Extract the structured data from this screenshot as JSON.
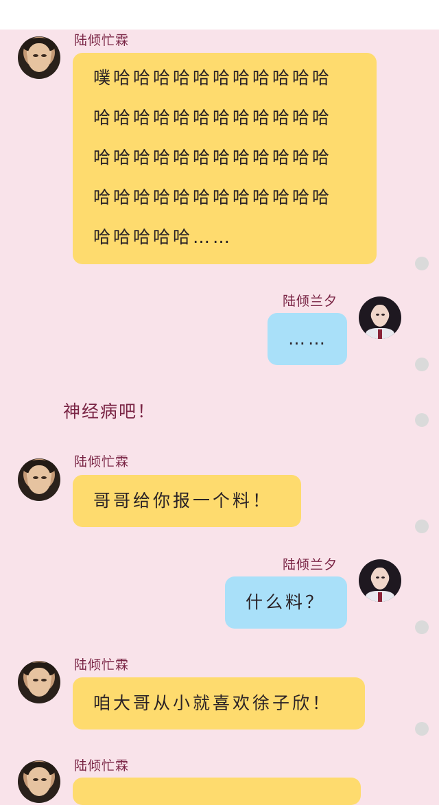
{
  "colors": {
    "background": "#f9e3ea",
    "name": "#7a2545",
    "yellow_bubble": "#fedb6e",
    "blue_bubble": "#a9e0f9",
    "dot": "#dadada"
  },
  "messages": [
    {
      "sender": "陆倾忙霖",
      "side": "left",
      "lines": [
        "噗哈哈哈哈哈哈哈哈哈哈哈",
        "哈哈哈哈哈哈哈哈哈哈哈哈",
        "哈哈哈哈哈哈哈哈哈哈哈哈",
        "哈哈哈哈哈哈哈哈哈哈哈哈",
        "哈哈哈哈哈……"
      ]
    },
    {
      "sender": "陆倾兰夕",
      "side": "right",
      "text": "……"
    },
    {
      "sender": "陆倾忙霖",
      "side": "left",
      "text": "哥哥给你报一个料！"
    },
    {
      "sender": "陆倾兰夕",
      "side": "right",
      "text": "什么料？"
    },
    {
      "sender": "陆倾忙霖",
      "side": "left",
      "text": "咱大哥从小就喜欢徐子欣！"
    },
    {
      "sender": "陆倾忙霖",
      "side": "left",
      "text": ""
    }
  ],
  "narration": "神经病吧！",
  "icons": {
    "left_avatar": "male-avatar",
    "right_avatar": "female-avatar",
    "status_dot": "gray-dot"
  }
}
